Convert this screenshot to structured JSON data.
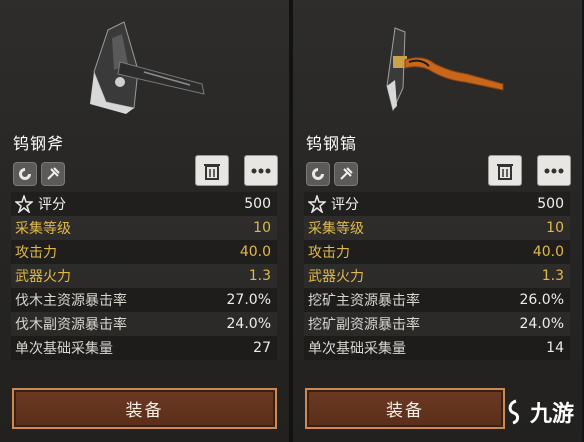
{
  "left": {
    "name": "钨钢斧",
    "stats": [
      {
        "label": "评分",
        "value": "500"
      },
      {
        "label": "采集等级",
        "value": "10"
      },
      {
        "label": "攻击力",
        "value": "40.0"
      },
      {
        "label": "武器火力",
        "value": "1.3"
      },
      {
        "label": "伐木主资源暴击率",
        "value": "27.0%"
      },
      {
        "label": "伐木副资源暴击率",
        "value": "24.0%"
      },
      {
        "label": "单次基础采集量",
        "value": "27"
      }
    ],
    "equip_label": "装备"
  },
  "right": {
    "name": "钨钢镐",
    "stats": [
      {
        "label": "评分",
        "value": "500"
      },
      {
        "label": "采集等级",
        "value": "10"
      },
      {
        "label": "攻击力",
        "value": "40.0"
      },
      {
        "label": "武器火力",
        "value": "1.3"
      },
      {
        "label": "挖矿主资源暴击率",
        "value": "26.0%"
      },
      {
        "label": "挖矿副资源暴击率",
        "value": "24.0%"
      },
      {
        "label": "单次基础采集量",
        "value": "14"
      }
    ],
    "equip_label": "装备"
  },
  "watermark": "九游",
  "colors": {
    "gold": "#e0b94a",
    "button_fill": "#5a2e1b",
    "button_border": "#c98a56"
  }
}
